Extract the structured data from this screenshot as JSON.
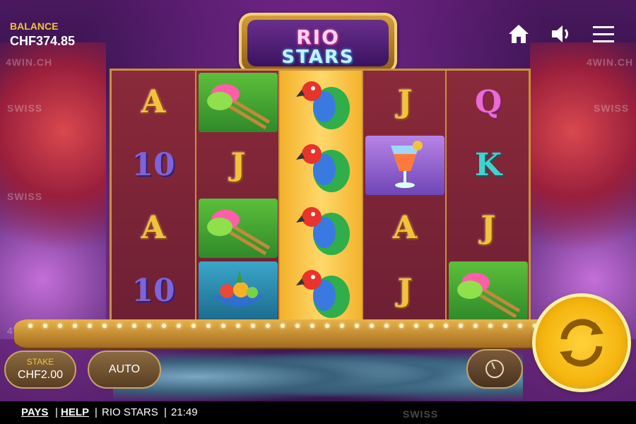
{
  "header": {
    "balance_label": "BALANCE",
    "balance_value": "CHF374.85",
    "icons": [
      "home-icon",
      "sound-icon",
      "menu-icon"
    ]
  },
  "title": {
    "line1": "RIO",
    "line2": "STARS"
  },
  "reels": [
    [
      "A",
      "10",
      "A",
      "10"
    ],
    [
      "maracas",
      "J",
      "maracas",
      "fruit-bowl"
    ],
    [
      "parrot",
      "parrot",
      "parrot",
      "parrot"
    ],
    [
      "J",
      "cocktail",
      "A",
      "J"
    ],
    [
      "Q",
      "K",
      "J",
      "maracas"
    ]
  ],
  "watermark": {
    "brand": "SWISS",
    "sub": "4WIN.CH"
  },
  "controls": {
    "stake_label": "STAKE",
    "stake_value": "CHF2.00",
    "auto_label": "AUTO"
  },
  "footer": {
    "pays": "PAYS",
    "help": "HELP",
    "game_name": "RIO STARS",
    "time": "21:49"
  },
  "colors": {
    "accent": "#f3c23c",
    "spin": "#f5b50f",
    "reel_bg": "#7a2438"
  }
}
